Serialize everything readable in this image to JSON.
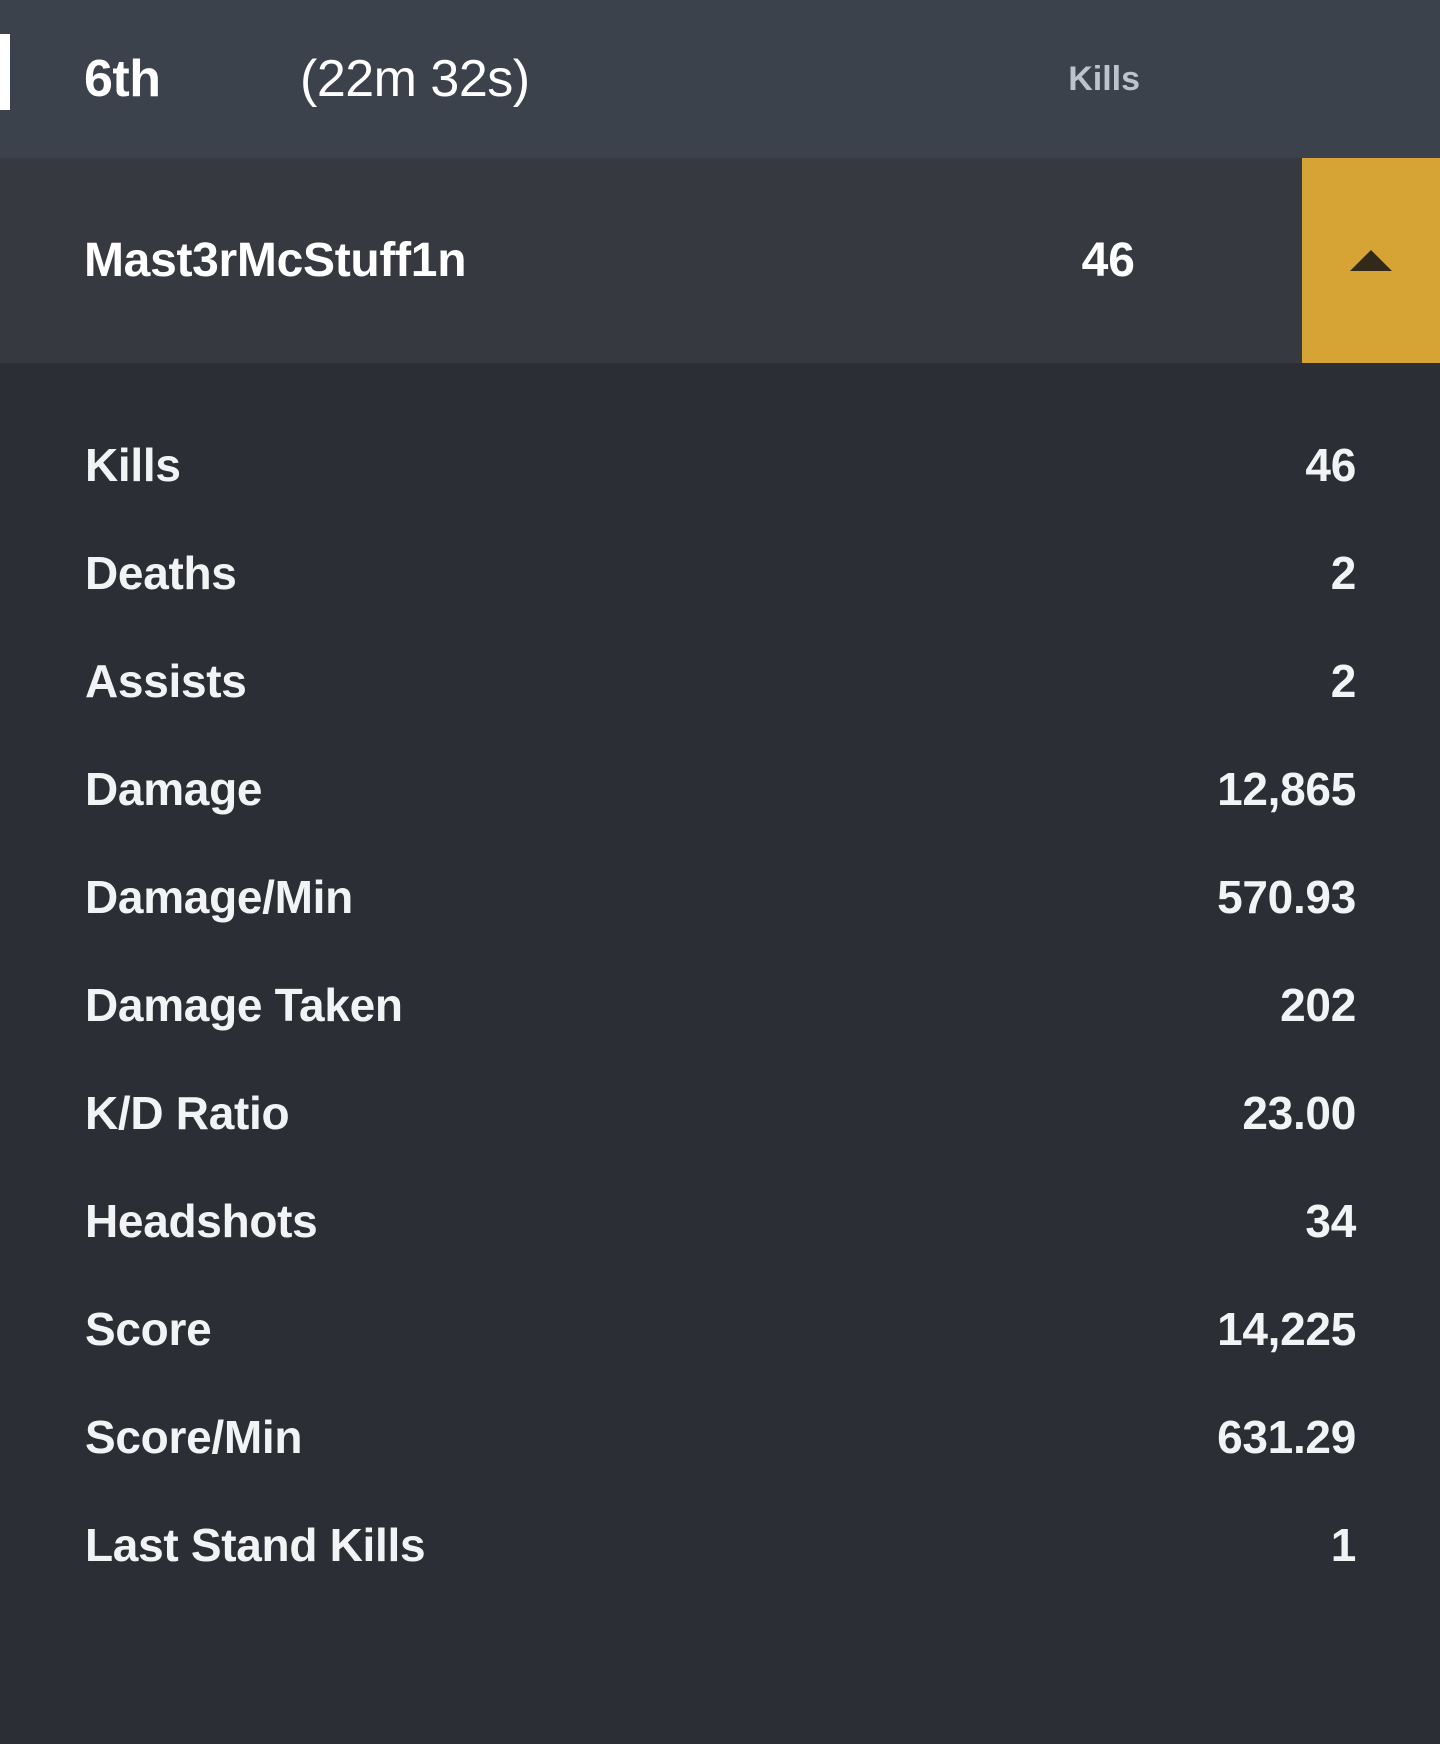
{
  "header": {
    "placement": "6th",
    "duration": "(22m 32s)",
    "metric_label": "Kills",
    "bar_color": "#3c424c",
    "marker_color": "#ffffff",
    "metric_label_color": "#bcc3cd"
  },
  "player": {
    "name": "Mast3rMcStuff1n",
    "metric_value": "46",
    "row_color": "#363a40",
    "toggle": {
      "icon": "caret-up-icon",
      "background_color": "#d6a434",
      "icon_color": "#33291a",
      "expanded": true
    }
  },
  "stats": [
    {
      "label": "Kills",
      "value": "46"
    },
    {
      "label": "Deaths",
      "value": "2"
    },
    {
      "label": "Assists",
      "value": "2"
    },
    {
      "label": "Damage",
      "value": "12,865"
    },
    {
      "label": "Damage/Min",
      "value": "570.93"
    },
    {
      "label": "Damage Taken",
      "value": "202"
    },
    {
      "label": "K/D Ratio",
      "value": "23.00"
    },
    {
      "label": "Headshots",
      "value": "34"
    },
    {
      "label": "Score",
      "value": "14,225"
    },
    {
      "label": "Score/Min",
      "value": "631.29"
    },
    {
      "label": "Last Stand Kills",
      "value": "1"
    }
  ],
  "theme": {
    "page_background": "#2b2e34",
    "text_primary": "#f2f3f5"
  }
}
